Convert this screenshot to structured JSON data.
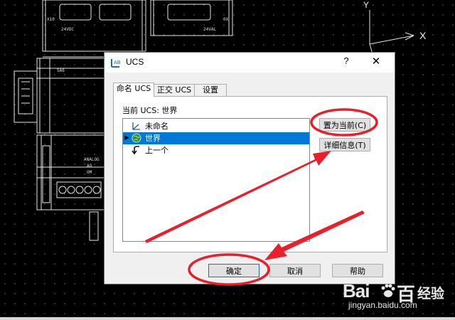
{
  "cad": {
    "axis_x_label": "X",
    "axis_y_label": "Y",
    "labels": {
      "x10": "X10",
      "x24vdc": "24VDC",
      "x24val": "24VAL",
      "x0x": "0X",
      "sa6": "SA6",
      "analog": "ANALOG",
      "ao": "AO",
      "om": "OM"
    }
  },
  "dialog": {
    "title": "UCS",
    "help": "?",
    "close": "✕",
    "tabs": [
      {
        "label": "命名 UCS",
        "active": true
      },
      {
        "label": "正交 UCS",
        "active": false
      },
      {
        "label": "设置",
        "active": false
      }
    ],
    "current_ucs_label": "当前 UCS:  世界",
    "list_items": [
      {
        "label": "未命名",
        "icon": "ucs-axis-icon",
        "selected": false
      },
      {
        "label": "世界",
        "icon": "globe-icon",
        "selected": true
      },
      {
        "label": "上一个",
        "icon": "undo-arrow-icon",
        "selected": false
      }
    ],
    "buttons": {
      "set_current": "置为当前(C)",
      "details": "详细信息(T)",
      "ok": "确定",
      "cancel": "取消",
      "help": "帮助"
    }
  },
  "annotations": {
    "color": "#e8202c"
  },
  "watermark": {
    "brand": "Bai",
    "brand_end": "百",
    "jingyan": "经验",
    "url": "jingyan.baidu.com"
  }
}
